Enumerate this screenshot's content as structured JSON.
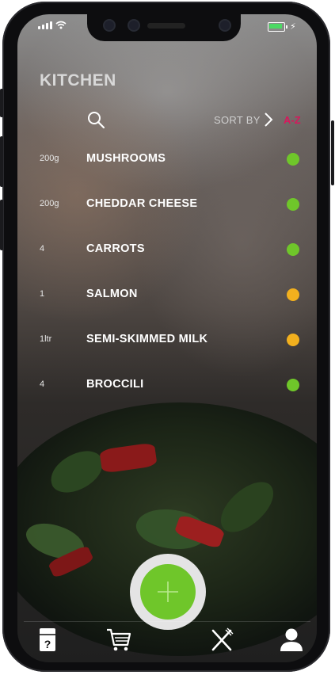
{
  "status_bar": {
    "signal_icon": "cellular-signal-icon",
    "wifi_icon": "wifi-icon",
    "battery_icon": "battery-charging-icon",
    "battery_color": "#4cd964"
  },
  "header": {
    "title": "KITCHEN",
    "search_icon": "search-icon",
    "sort_label": "SORT BY",
    "sort_value": "A-Z",
    "sort_value_color": "#d8175c"
  },
  "items": [
    {
      "qty": "200g",
      "name": "MUSHROOMS",
      "status_color": "#6fc62a"
    },
    {
      "qty": "200g",
      "name": "CHEDDAR CHEESE",
      "status_color": "#6fc62a"
    },
    {
      "qty": "4",
      "name": "CARROTS",
      "status_color": "#6fc62a"
    },
    {
      "qty": "1",
      "name": "SALMON",
      "status_color": "#f2b01e"
    },
    {
      "qty": "1ltr",
      "name": "SEMI-SKIMMED MILK",
      "status_color": "#f2b01e"
    },
    {
      "qty": "4",
      "name": "BROCCILI",
      "status_color": "#6fc62a"
    }
  ],
  "fab": {
    "icon": "plus-icon",
    "color": "#6fc62a"
  },
  "tab_bar": [
    {
      "icon": "fridge-help-icon"
    },
    {
      "icon": "shopping-cart-icon"
    },
    {
      "icon": "fork-knife-icon"
    },
    {
      "icon": "user-icon"
    }
  ]
}
